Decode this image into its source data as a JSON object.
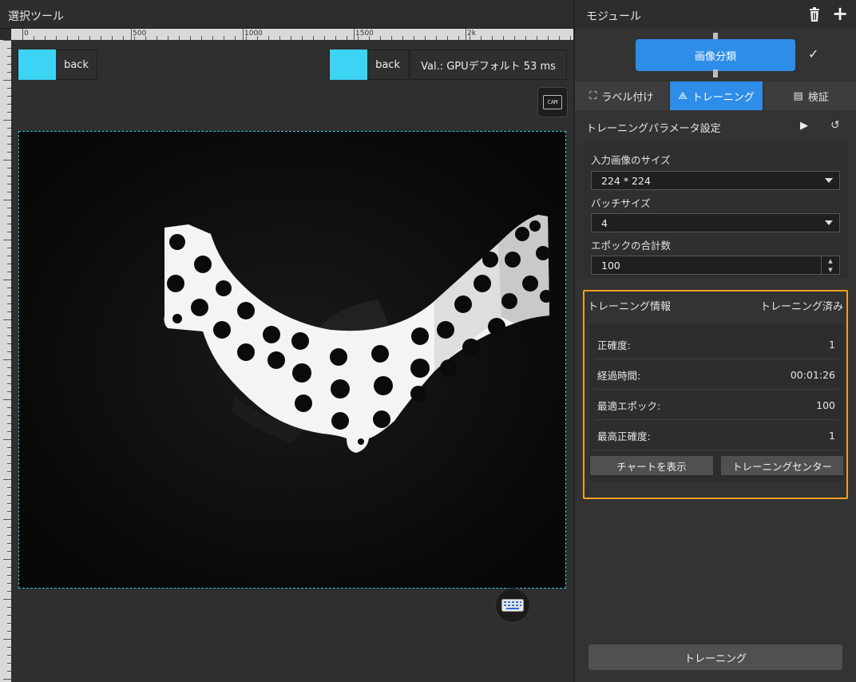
{
  "left": {
    "title": "選択ツール",
    "ruler_top_labels": [
      "0",
      "500",
      "1000",
      "1500",
      "2k"
    ],
    "legend_left": {
      "label": "back",
      "color": "#3cd3f5"
    },
    "legend_right": {
      "label": "back",
      "color": "#3cd3f5",
      "info": "Val.: GPUデフォルト 53 ms"
    },
    "cam_icon_text": "CAM"
  },
  "right": {
    "module_title": "モジュール",
    "module_node": "画像分類",
    "tabs": [
      {
        "label": "ラベル付け",
        "icon": "bounding-box-icon"
      },
      {
        "label": "トレーニング",
        "icon": "network-icon"
      },
      {
        "label": "検証",
        "icon": "report-icon"
      }
    ],
    "params": {
      "title": "トレーニングパラメータ設定",
      "input_size_label": "入力画像のサイズ",
      "input_size_value": "224 * 224",
      "batch_label": "バッチサイズ",
      "batch_value": "4",
      "epoch_label": "エポックの合計数",
      "epoch_value": "100"
    },
    "info": {
      "title": "トレーニング情報",
      "status": "トレーニング済み",
      "rows": [
        {
          "label": "正確度:",
          "value": "1"
        },
        {
          "label": "経過時間:",
          "value": "00:01:26"
        },
        {
          "label": "最適エポック:",
          "value": "100"
        },
        {
          "label": "最高正確度:",
          "value": "1"
        }
      ],
      "chart_button": "チャートを表示",
      "center_button": "トレーニングセンター"
    },
    "train_button": "トレーニング",
    "colors": {
      "accent": "#2e8de8",
      "highlight": "#f0a022",
      "legend": "#3cd3f5",
      "frame": "#2cc5d2"
    }
  }
}
